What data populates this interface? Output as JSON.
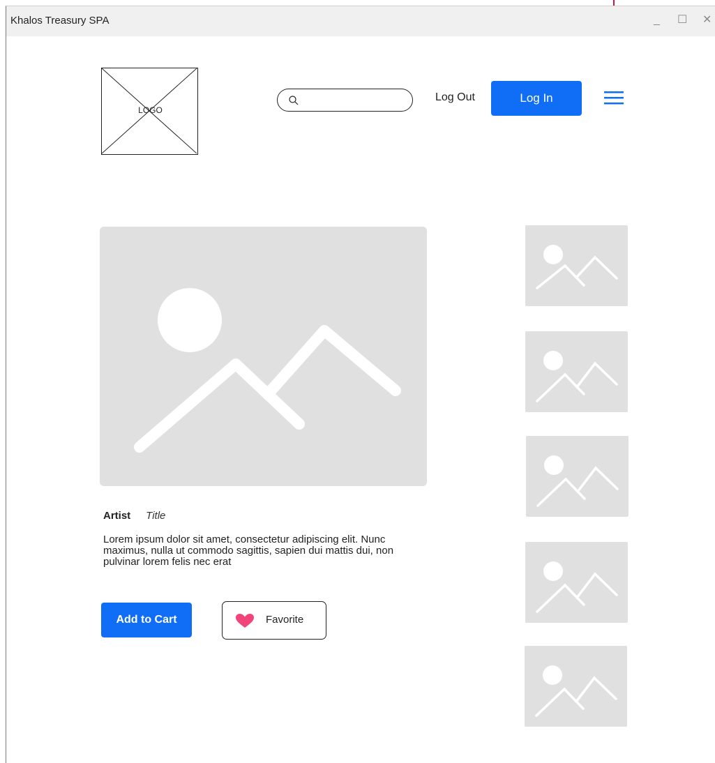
{
  "window": {
    "title": "Khalos Treasury SPA",
    "controls": [
      "_",
      "☐",
      "✕"
    ]
  },
  "header": {
    "logo_text": "LOGO",
    "search_placeholder": "",
    "search_value": "",
    "logout_label": "Log Out",
    "login_label": "Log In",
    "menu_icon": "hamburger-menu-icon"
  },
  "product": {
    "artist": "Artist",
    "title": "Title",
    "description": "Lorem ipsum dolor sit amet, consectetur adipiscing elit. Nunc maximus, nulla ut commodo sagittis, sapien dui mattis dui, non pulvinar lorem felis nec erat",
    "add_to_cart_label": "Add to Cart",
    "favorite_label": "Favorite"
  },
  "colors": {
    "accent": "#0f6ef5",
    "heart": "#f0447a",
    "placeholder": "#e0e0e0",
    "annotation": "#d4143c"
  }
}
